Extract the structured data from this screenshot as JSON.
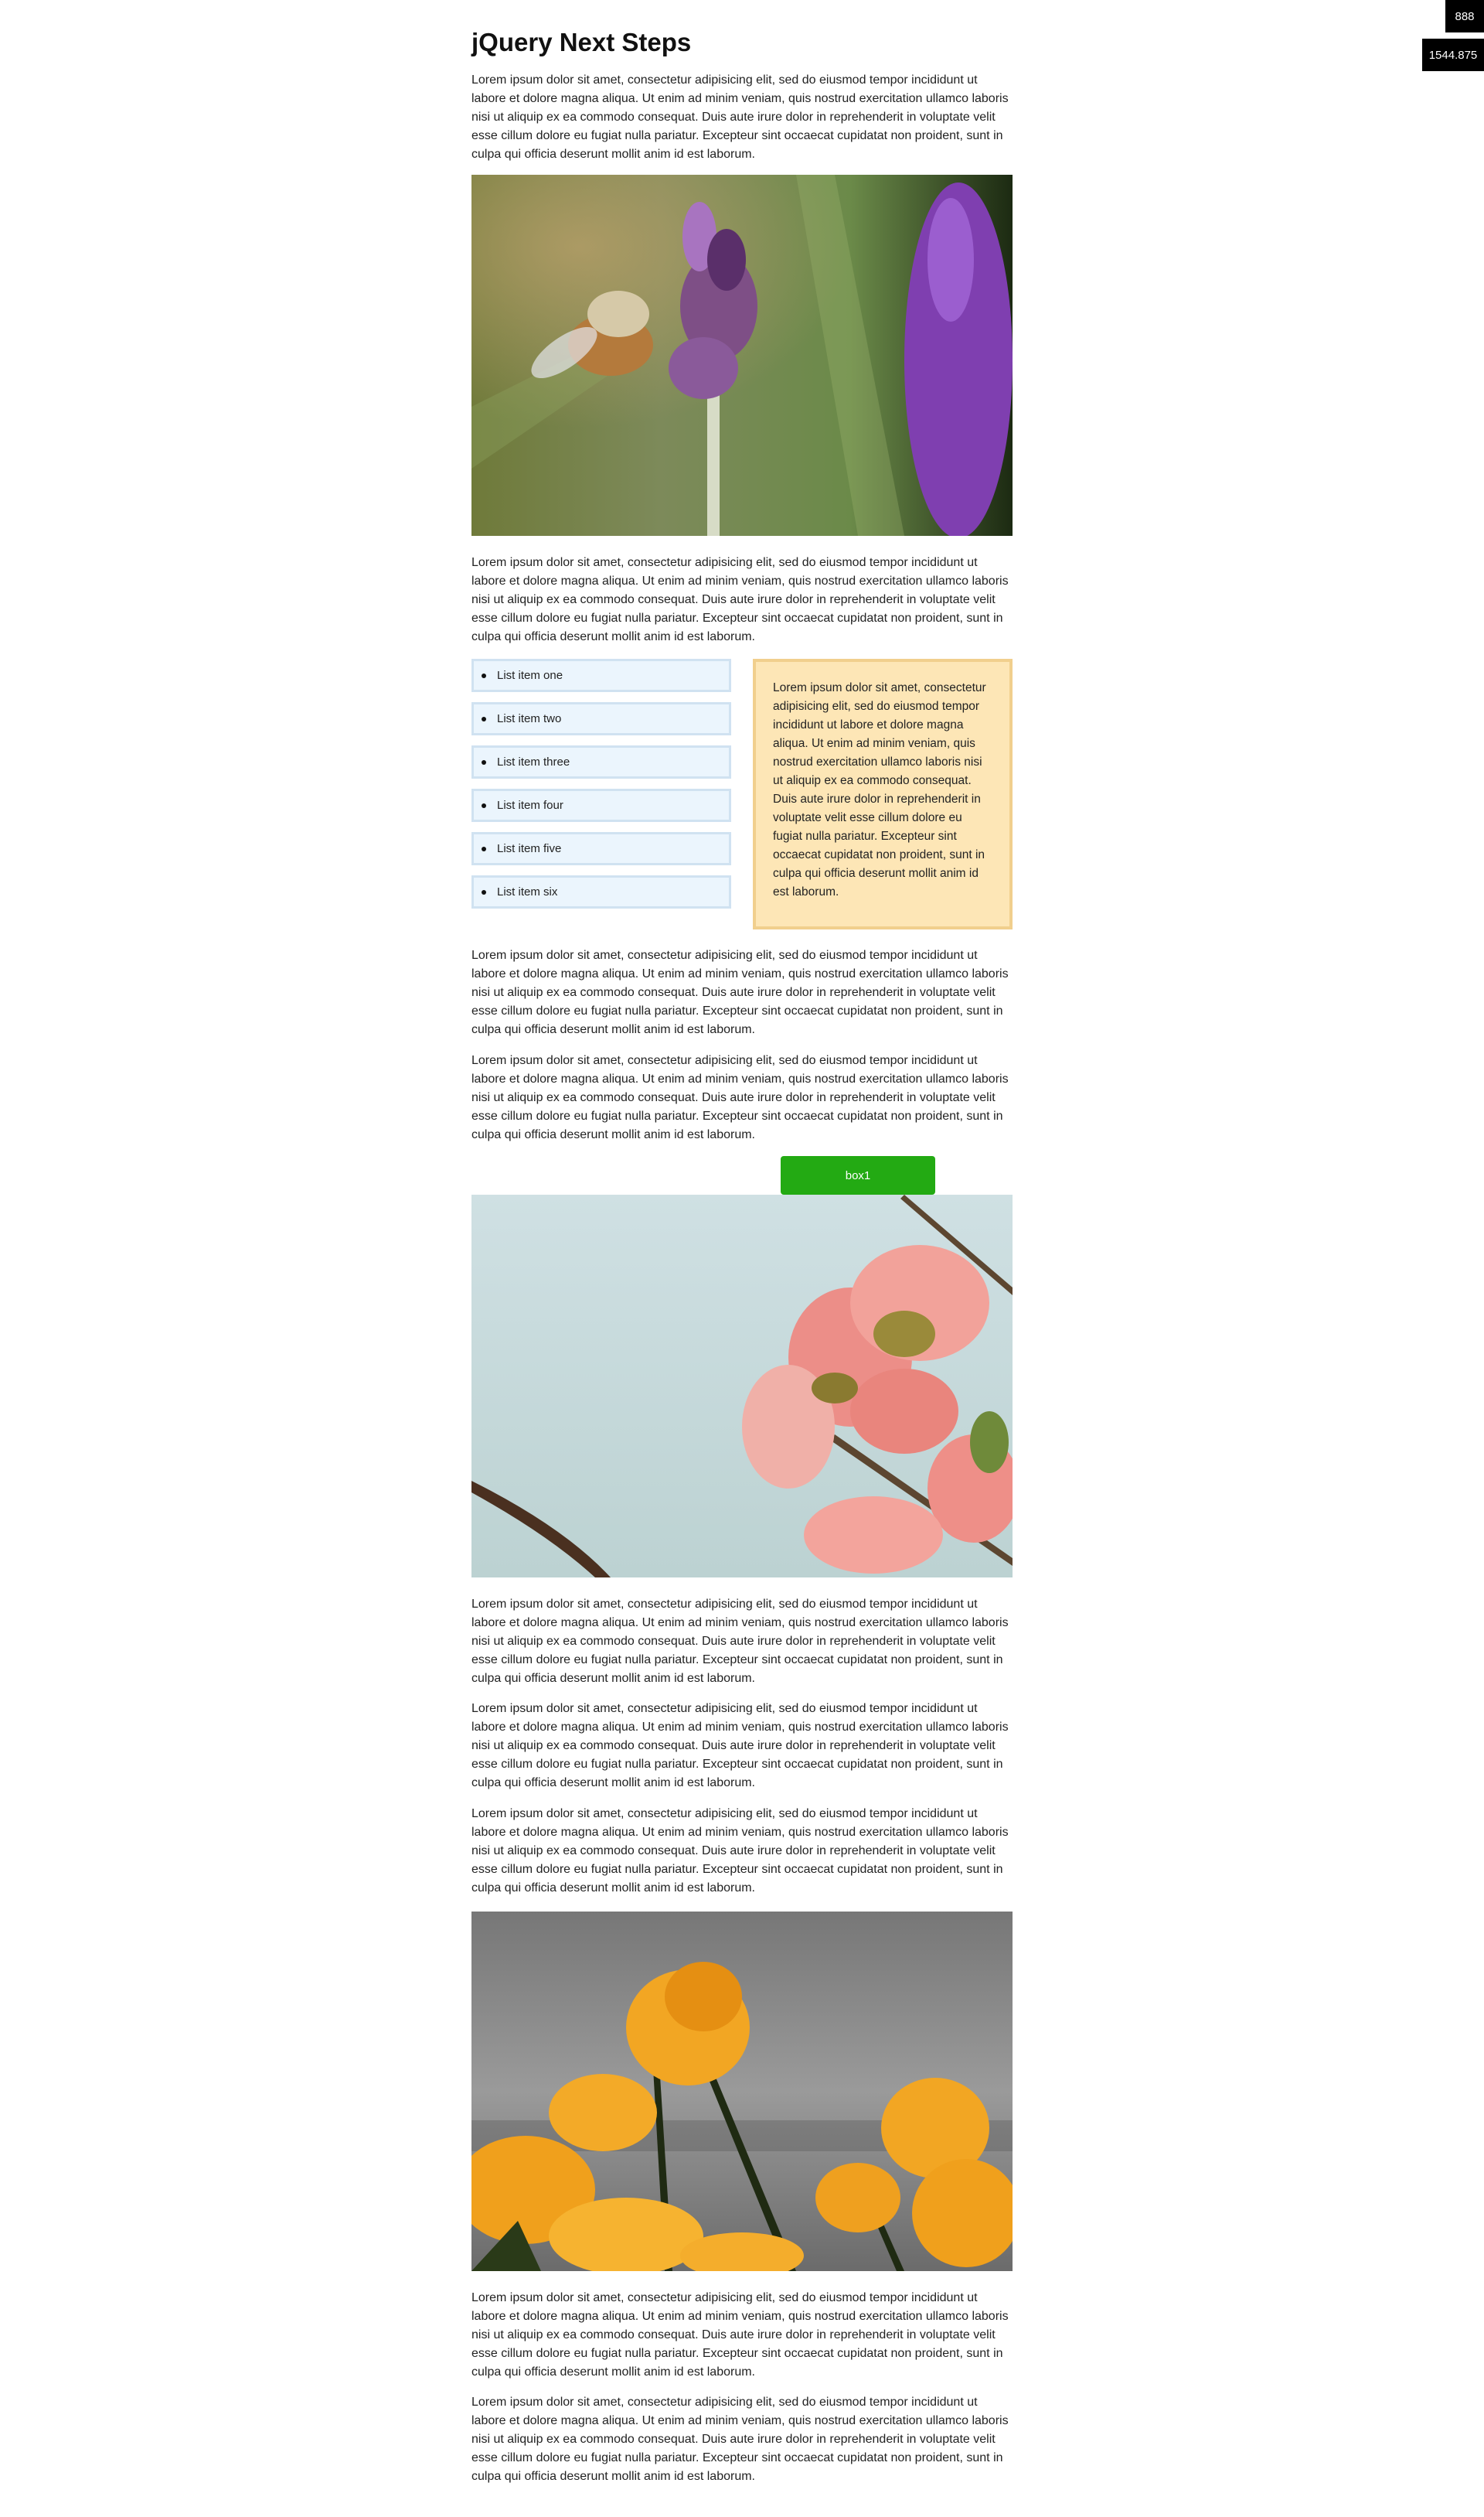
{
  "page": {
    "title": "jQuery Next Steps"
  },
  "lorem": "Lorem ipsum dolor sit amet, consectetur adipisicing elit, sed do eiusmod tempor incididunt ut labore et dolore magna aliqua. Ut enim ad minim veniam, quis nostrud exercitation ullamco laboris nisi ut aliquip ex ea commodo consequat. Duis aute irure dolor in reprehenderit in voluptate velit esse cillum dolore eu fugiat nulla pariatur. Excepteur sint occaecat cupidatat non proident, sunt in culpa qui officia deserunt mollit anim id est laborum.",
  "list": {
    "items": [
      "List item one",
      "List item two",
      "List item three",
      "List item four",
      "List item five",
      "List item six"
    ]
  },
  "aside": {
    "text": "Lorem ipsum dolor sit amet, consectetur adipisicing elit, sed do eiusmod tempor incididunt ut labore et dolore magna aliqua. Ut enim ad minim veniam, quis nostrud exercitation ullamco laboris nisi ut aliquip ex ea commodo consequat. Duis aute irure dolor in reprehenderit in voluptate velit esse cillum dolore eu fugiat nulla pariatur. Excepteur sint occaecat cupidatat non proident, sunt in culpa qui officia deserunt mollit anim id est laborum."
  },
  "box1": {
    "label": "box1"
  },
  "viewport_badges": {
    "width": "888",
    "scroll": "1544.875"
  },
  "images": {
    "bee": "bee-on-lavender-photo",
    "dogwood": "pink-dogwood-flowers-photo",
    "poppies": "orange-poppies-photo"
  },
  "colors": {
    "box1_bg": "#23aa13",
    "list_bg": "#ebf5fd",
    "aside_bg": "#fde6b6",
    "aside_border": "#f1cf8d"
  }
}
